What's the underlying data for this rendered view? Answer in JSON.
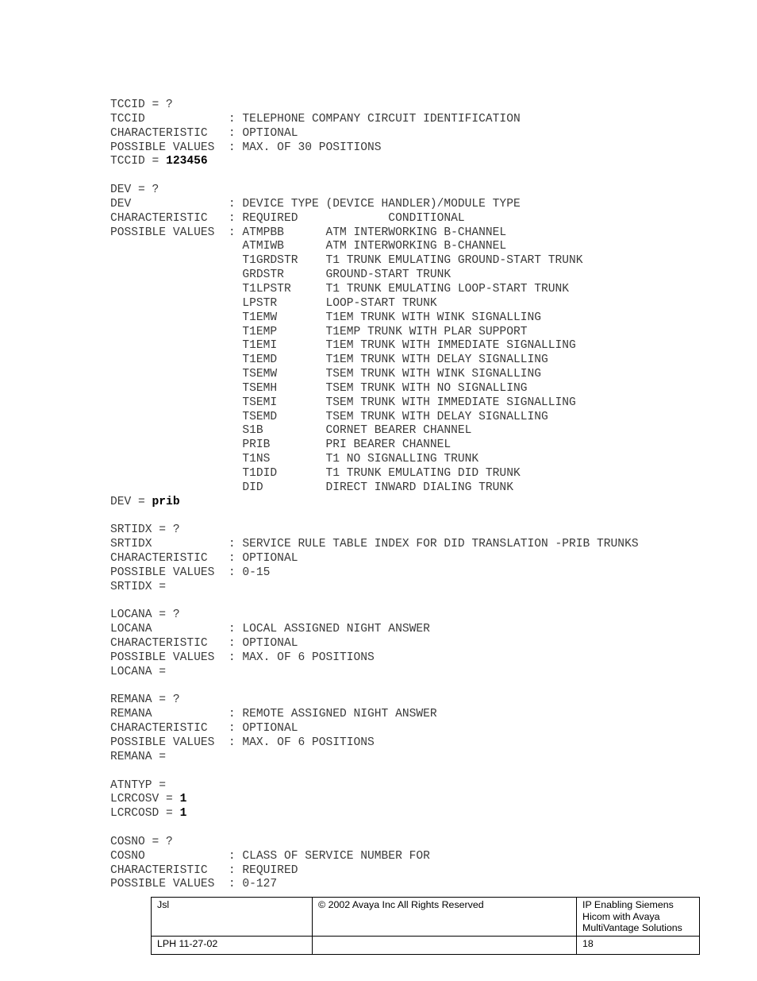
{
  "document": {
    "lines": [
      {
        "text": "TCCID = ?"
      },
      {
        "text": "TCCID            : TELEPHONE COMPANY CIRCUIT IDENTIFICATION"
      },
      {
        "text": "CHARACTERISTIC   : OPTIONAL"
      },
      {
        "text": "POSSIBLE VALUES  : MAX. OF 30 POSITIONS"
      },
      {
        "text": "TCCID = ",
        "bold": "123456"
      },
      {
        "text": ""
      },
      {
        "text": "DEV = ?"
      },
      {
        "text": "DEV              : DEVICE TYPE (DEVICE HANDLER)/MODULE TYPE"
      },
      {
        "text": "CHARACTERISTIC   : REQUIRED             CONDITIONAL"
      },
      {
        "text": "POSSIBLE VALUES  : ATMPBB      ATM INTERWORKING B-CHANNEL"
      },
      {
        "text": "                   ATMIWB      ATM INTERWORKING B-CHANNEL"
      },
      {
        "text": "                   T1GRDSTR    T1 TRUNK EMULATING GROUND-START TRUNK"
      },
      {
        "text": "                   GRDSTR      GROUND-START TRUNK"
      },
      {
        "text": "                   T1LPSTR     T1 TRUNK EMULATING LOOP-START TRUNK"
      },
      {
        "text": "                   LPSTR       LOOP-START TRUNK"
      },
      {
        "text": "                   T1EMW       T1EM TRUNK WITH WINK SIGNALLING"
      },
      {
        "text": "                   T1EMP       T1EMP TRUNK WITH PLAR SUPPORT"
      },
      {
        "text": "                   T1EMI       T1EM TRUNK WITH IMMEDIATE SIGNALLING"
      },
      {
        "text": "                   T1EMD       T1EM TRUNK WITH DELAY SIGNALLING"
      },
      {
        "text": "                   TSEMW       TSEM TRUNK WITH WINK SIGNALLING"
      },
      {
        "text": "                   TSEMH       TSEM TRUNK WITH NO SIGNALLING"
      },
      {
        "text": "                   TSEMI       TSEM TRUNK WITH IMMEDIATE SIGNALLING"
      },
      {
        "text": "                   TSEMD       TSEM TRUNK WITH DELAY SIGNALLING"
      },
      {
        "text": "                   S1B         CORNET BEARER CHANNEL"
      },
      {
        "text": "                   PRIB        PRI BEARER CHANNEL"
      },
      {
        "text": "                   T1NS        T1 NO SIGNALLING TRUNK"
      },
      {
        "text": "                   T1DID       T1 TRUNK EMULATING DID TRUNK"
      },
      {
        "text": "                   DID         DIRECT INWARD DIALING TRUNK"
      },
      {
        "text": "DEV = ",
        "bold": "prib"
      },
      {
        "text": ""
      },
      {
        "text": "SRTIDX = ?"
      },
      {
        "text": "SRTIDX           : SERVICE RULE TABLE INDEX FOR DID TRANSLATION -PRIB TRUNKS"
      },
      {
        "text": "CHARACTERISTIC   : OPTIONAL"
      },
      {
        "text": "POSSIBLE VALUES  : 0-15"
      },
      {
        "text": "SRTIDX ="
      },
      {
        "text": ""
      },
      {
        "text": "LOCANA = ?"
      },
      {
        "text": "LOCANA           : LOCAL ASSIGNED NIGHT ANSWER"
      },
      {
        "text": "CHARACTERISTIC   : OPTIONAL"
      },
      {
        "text": "POSSIBLE VALUES  : MAX. OF 6 POSITIONS"
      },
      {
        "text": "LOCANA ="
      },
      {
        "text": ""
      },
      {
        "text": "REMANA = ?"
      },
      {
        "text": "REMANA           : REMOTE ASSIGNED NIGHT ANSWER"
      },
      {
        "text": "CHARACTERISTIC   : OPTIONAL"
      },
      {
        "text": "POSSIBLE VALUES  : MAX. OF 6 POSITIONS"
      },
      {
        "text": "REMANA ="
      },
      {
        "text": ""
      },
      {
        "text": "ATNTYP ="
      },
      {
        "text": "LCRCOSV = ",
        "bold": "1"
      },
      {
        "text": "LCRCOSD = ",
        "bold": "1"
      },
      {
        "text": ""
      },
      {
        "text": "COSNO = ?"
      },
      {
        "text": "COSNO            : CLASS OF SERVICE NUMBER FOR"
      },
      {
        "text": "CHARACTERISTIC   : REQUIRED"
      },
      {
        "text": "POSSIBLE VALUES  : 0-127"
      }
    ]
  },
  "footer": {
    "author": "Jsl",
    "copyright": "© 2002 Avaya Inc All Rights Reserved",
    "product": "IP Enabling Siemens Hicom with Avaya MultiVantage Solutions",
    "doc_id": "LPH 11-27-02",
    "empty_cell": "",
    "page_number": "18"
  }
}
